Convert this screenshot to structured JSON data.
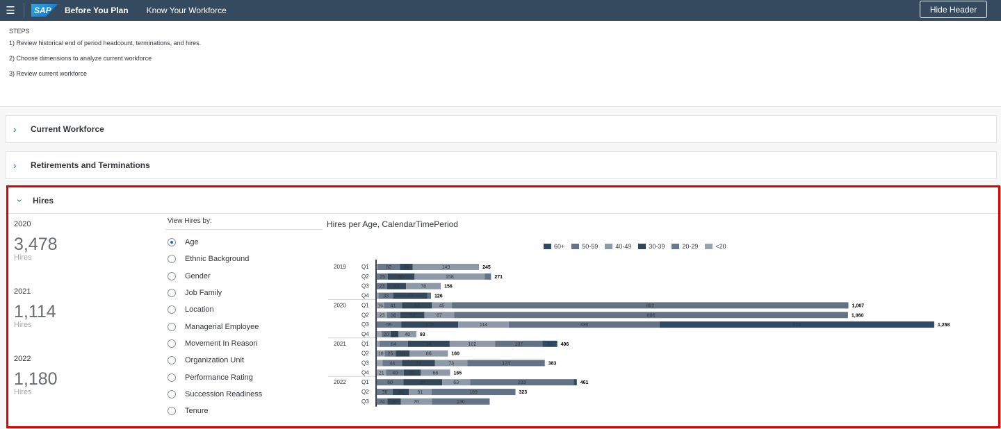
{
  "header": {
    "menu_icon": "hamburger-icon",
    "logo_text": "SAP",
    "app_title": "Before You Plan",
    "app_subtitle": "Know Your Workforce",
    "hide_header_label": "Hide Header"
  },
  "steps": {
    "heading": "STEPS",
    "items": [
      "1) Review historical end of period headcount, terminations, and hires.",
      "2) Choose dimensions to analyze current workforce",
      "3) Review current workforce"
    ]
  },
  "panels": {
    "current_workforce": "Current Workforce",
    "retirements": "Retirements and Terminations",
    "hires": "Hires"
  },
  "stats": [
    {
      "year": "2020",
      "value": "3,478",
      "label": "Hires"
    },
    {
      "year": "2021",
      "value": "1,114",
      "label": "Hires"
    },
    {
      "year": "2022",
      "value": "1,180",
      "label": "Hires"
    }
  ],
  "view_by": {
    "heading": "View Hires by:",
    "selected": "Age",
    "options": [
      "Age",
      "Ethnic Background",
      "Gender",
      "Job Family",
      "Location",
      "Managerial Employee",
      "Movement In Reason",
      "Organization Unit",
      "Performance Rating",
      "Succession Readiness",
      "Tenure"
    ]
  },
  "colors": {
    "accent": "#0a6ed1",
    "shell": "#354a5f",
    "highlight": "#e00000",
    "s60": "#2f4a65",
    "s50": "#637385",
    "s40": "#8f9aa8",
    "s30": "#34475a",
    "s20": "#6a7a8c",
    "s10": "#9aa3ae"
  },
  "chart_data": {
    "type": "bar",
    "orientation": "horizontal",
    "stacked": true,
    "title": "Hires per Age, CalendarTimePeriod",
    "legend": [
      "60+",
      "50-59",
      "40-49",
      "30-39",
      "20-29",
      "<20"
    ],
    "legend_position": "top",
    "segment_order": [
      "<20",
      "20-29",
      "30-39",
      "40-49",
      "50-59",
      "60+"
    ],
    "groups": [
      {
        "year": "2019",
        "rows": [
          {
            "q": "Q1",
            "segs": [
              2,
              50,
              29,
              149,
              0,
              0
            ],
            "total": "245"
          },
          {
            "q": "Q2",
            "segs": [
              0,
              25,
              60,
              158,
              14,
              0
            ],
            "total": "271"
          },
          {
            "q": "Q3",
            "segs": [
              0,
              23,
              43,
              78,
              0,
              0
            ],
            "total": "156"
          },
          {
            "q": "Q4",
            "segs": [
              4,
              33,
              77,
              0,
              8,
              0
            ],
            "total": "126"
          }
        ]
      },
      {
        "year": "2020",
        "rows": [
          {
            "q": "Q1",
            "segs": [
              16,
              41,
              67,
              45,
              892,
              0
            ],
            "total": "1,067"
          },
          {
            "q": "Q2",
            "segs": [
              23,
              30,
              54,
              67,
              886,
              0
            ],
            "total": "1,060"
          },
          {
            "q": "Q3",
            "segs": [
              0,
              55,
              128,
              114,
              339,
              618
            ],
            "total": "1,258"
          },
          {
            "q": "Q4",
            "segs": [
              11,
              20,
              18,
              40,
              0,
              0
            ],
            "total": "93"
          }
        ]
      },
      {
        "year": "2021",
        "rows": [
          {
            "q": "Q1",
            "segs": [
              6,
              64,
              94,
              102,
              107,
              33
            ],
            "total": "406"
          },
          {
            "q": "Q2",
            "segs": [
              18,
              25,
              31,
              86,
              0,
              0
            ],
            "total": "160"
          },
          {
            "q": "Q3",
            "segs": [
              13,
              44,
              74,
              73,
              174,
              0
            ],
            "total": "383"
          },
          {
            "q": "Q4",
            "segs": [
              21,
              40,
              38,
              66,
              0,
              0
            ],
            "total": "165"
          }
        ]
      },
      {
        "year": "2022",
        "rows": [
          {
            "q": "Q1",
            "segs": [
              0,
              60,
              87,
              63,
              233,
              7
            ],
            "total": "461"
          },
          {
            "q": "Q2",
            "segs": [
              0,
              36,
              36,
              51,
              189,
              0
            ],
            "total": "323"
          },
          {
            "q": "Q3",
            "segs": [
              0,
              24,
              30,
              70,
              130,
              0
            ],
            "total": ""
          }
        ]
      }
    ]
  }
}
